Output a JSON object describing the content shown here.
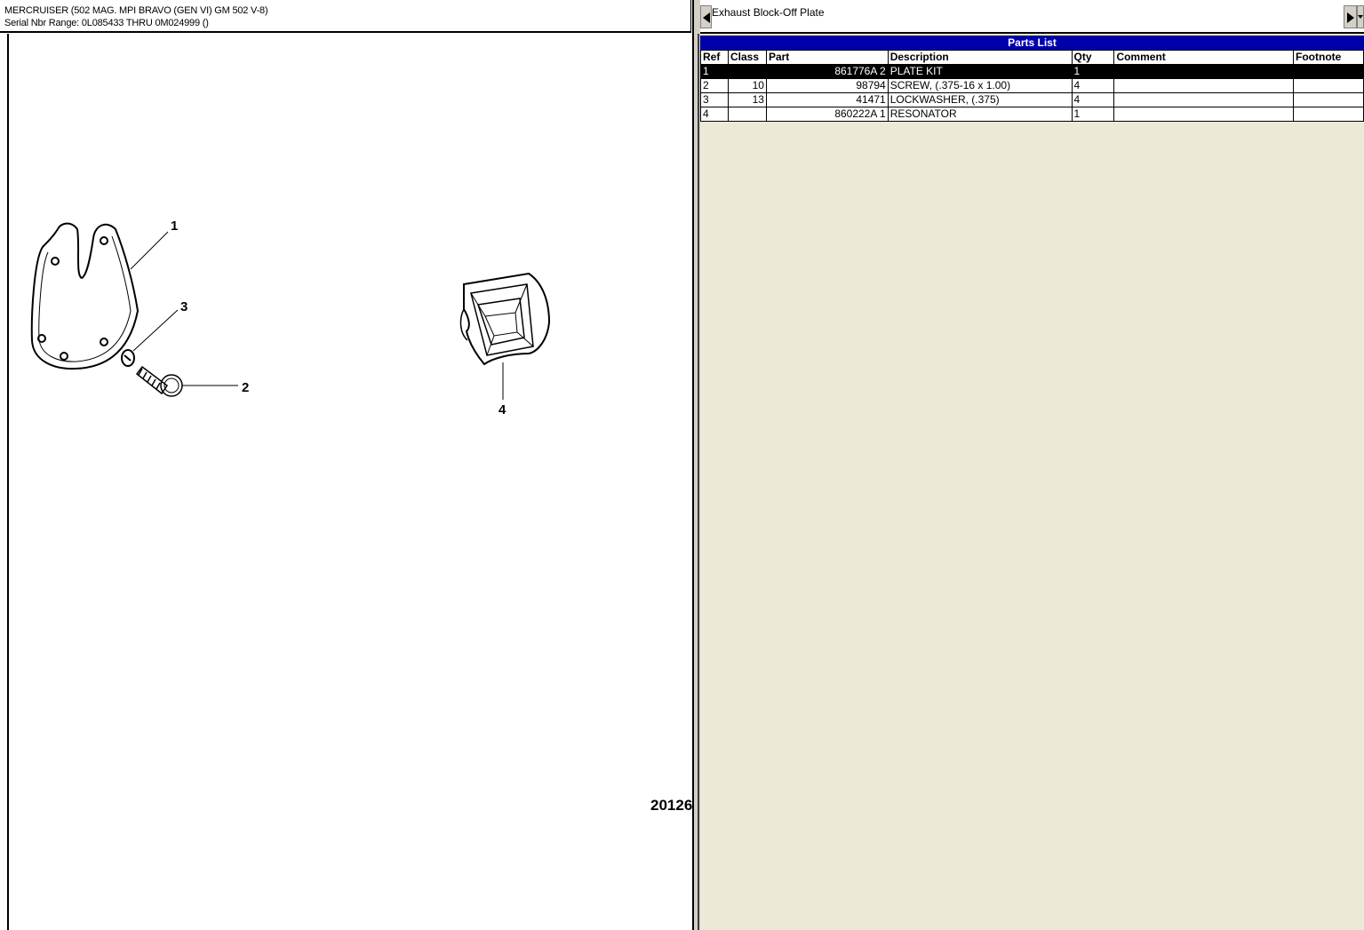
{
  "header": {
    "line1": "MERCRUISER (502 MAG. MPI BRAVO (GEN VI) GM 502 V-8)",
    "line2": "Serial Nbr Range: 0L085433 THRU 0M024999 ()"
  },
  "diagram": {
    "callouts": [
      "1",
      "3",
      "2",
      "4"
    ],
    "figure_number": "20126"
  },
  "title_bar": {
    "title": "Exhaust Block-Off Plate"
  },
  "parts_list": {
    "title": "Parts List",
    "columns": [
      "Ref",
      "Class",
      "Part",
      "Description",
      "Qty",
      "Comment",
      "Footnote"
    ],
    "rows": [
      {
        "ref": "1",
        "class": "",
        "part": "861776A 2",
        "description": "PLATE KIT",
        "qty": "1",
        "comment": "",
        "footnote": "",
        "selected": true
      },
      {
        "ref": "2",
        "class": "10",
        "part": "98794",
        "description": "SCREW, (.375-16 x 1.00)",
        "qty": "4",
        "comment": "",
        "footnote": "",
        "selected": false
      },
      {
        "ref": "3",
        "class": "13",
        "part": "41471",
        "description": "LOCKWASHER, (.375)",
        "qty": "4",
        "comment": "",
        "footnote": "",
        "selected": false
      },
      {
        "ref": "4",
        "class": "",
        "part": "860222A 1",
        "description": "RESONATOR",
        "qty": "1",
        "comment": "",
        "footnote": "",
        "selected": false
      }
    ]
  },
  "colors": {
    "header_bar": "#0000a8",
    "pane_background": "#ece9d8",
    "selected_row": "#000000"
  },
  "icons": [
    "left-arrow-icon",
    "right-arrow-icon",
    "dropdown-arrow-icon"
  ]
}
